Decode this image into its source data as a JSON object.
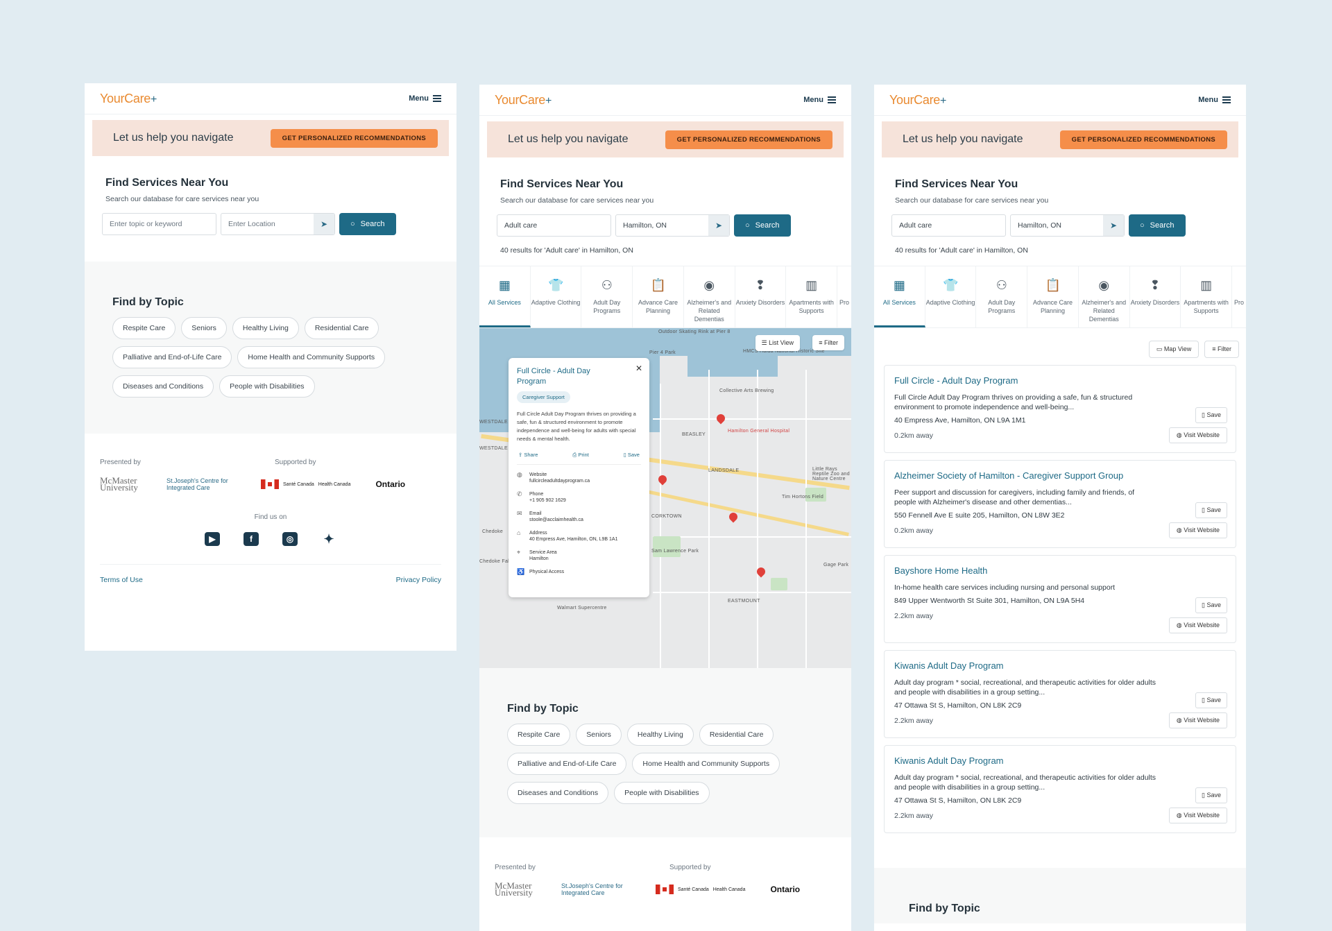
{
  "logo": {
    "text_a": "YourCare",
    "text_b": "+"
  },
  "menu_label": "Menu",
  "banner": {
    "text": "Let us help you navigate",
    "cta": "GET PERSONALIZED RECOMMENDATIONS"
  },
  "find": {
    "title": "Find Services Near You",
    "subtitle": "Search our database for care services near you",
    "topic_placeholder": "Enter topic or keyword",
    "location_placeholder": "Enter Location",
    "topic_value": "Adult care",
    "location_value": "Hamilton, ON",
    "search_label": "Search",
    "results_text": "40 results for 'Adult care' in Hamilton, ON"
  },
  "topics": {
    "title": "Find by Topic",
    "chips": [
      "Respite Care",
      "Seniors",
      "Healthy Living",
      "Residential Care",
      "Palliative and End-of-Life Care",
      "Home Health and Community Supports",
      "Diseases and Conditions",
      "People with Disabilities"
    ]
  },
  "footer": {
    "presented_by": "Presented by",
    "supported_by": "Supported by",
    "mcmaster": "McMaster University",
    "stjoseph": "St.Joseph's Centre for Integrated Care",
    "sante": "Santé Canada",
    "health": "Health Canada",
    "ontario": "Ontario",
    "find_us": "Find us on",
    "terms": "Terms of Use",
    "privacy": "Privacy Policy"
  },
  "tabs": [
    {
      "label": "All Services",
      "icon": "grid-icon"
    },
    {
      "label": "Adaptive Clothing",
      "icon": "shirt-icon"
    },
    {
      "label": "Adult Day Programs",
      "icon": "people-icon"
    },
    {
      "label": "Advance Care Planning",
      "icon": "clipboard-icon"
    },
    {
      "label": "Alzheimer's and Related Dementias",
      "icon": "head-spiral-icon"
    },
    {
      "label": "Anxiety Disorders",
      "icon": "head-alert-icon"
    },
    {
      "label": "Apartments with Supports",
      "icon": "building-icon"
    },
    {
      "label": "Pro",
      "icon": "partial-icon"
    }
  ],
  "map": {
    "list_view": "List View",
    "filter": "Filter",
    "map_view": "Map View",
    "labels": [
      "Outdoor Skating Rink at Pier 8",
      "Pier 4 Park",
      "HMCS Haida National Historic Site",
      "Collective Arts Brewing",
      "Hamilton General Hospital",
      "BEASLEY",
      "LANDSDALE",
      "Little Rays Reptile Zoo and Nature Centre",
      "Tim Hortons Field",
      "CORKTOWN",
      "Sam Lawrence Park",
      "Gage Park",
      "EASTMOUNT",
      "Walmart Supercentre",
      "WESTDALE",
      "WESTDALE SOUTH",
      "Chedoke",
      "Chedoke Falls"
    ]
  },
  "card": {
    "title": "Full Circle - Adult Day Program",
    "badge": "Caregiver Support",
    "desc": "Full Circle Adult Day Program thrives on providing a safe, fun & structured environment to promote independence and well-being for adults with special needs & mental health.",
    "share": "Share",
    "print": "Print",
    "save": "Save",
    "website_label": "Website",
    "website": "fullcircleadultdayprogram.ca",
    "phone_label": "Phone",
    "phone": "+1 905 902 1629",
    "email_label": "Email",
    "email": "stoole@acclaimhealth.ca",
    "address_label": "Address",
    "address": "40 Empress Ave, Hamilton, ON, L9B 1A1",
    "area_label": "Service Area",
    "area": "Hamilton",
    "access_label": "Physical Access"
  },
  "list": [
    {
      "title": "Full Circle - Adult Day Program",
      "desc": "Full Circle Adult Day Program thrives on providing a safe, fun & structured environment to promote independence and well-being...",
      "addr": "40 Empress Ave, Hamilton, ON L9A 1M1",
      "dist": "0.2km away"
    },
    {
      "title": "Alzheimer Society of Hamilton - Caregiver Support Group",
      "desc": "Peer support and discussion for caregivers, including family and friends, of people with Alzheimer's disease and other dementias...",
      "addr": "550 Fennell Ave E suite 205, Hamilton, ON L8W 3E2",
      "dist": "0.2km away"
    },
    {
      "title": "Bayshore Home Health",
      "desc": "In-home health care services including nursing and personal support",
      "addr": "849 Upper Wentworth St Suite 301, Hamilton, ON L9A 5H4",
      "dist": "2.2km away"
    },
    {
      "title": "Kiwanis Adult Day Program",
      "desc": "Adult day program * social, recreational, and therapeutic activities for older adults and people with disabilities in a group setting...",
      "addr": "47 Ottawa St S, Hamilton, ON L8K 2C9",
      "dist": "2.2km away"
    },
    {
      "title": "Kiwanis Adult Day Program",
      "desc": "Adult day program * social, recreational, and therapeutic activities for older adults and people with disabilities in a group setting...",
      "addr": "47 Ottawa St S, Hamilton, ON L8K 2C9",
      "dist": "2.2km away"
    }
  ],
  "save_label": "Save",
  "visit_label": "Visit Website",
  "find_topic_partial": "Find by Topic",
  "colors": {
    "accent": "#1e6a86",
    "cta": "#f58e4a",
    "banner": "#f6e3da",
    "background": "#e1ecf2"
  }
}
